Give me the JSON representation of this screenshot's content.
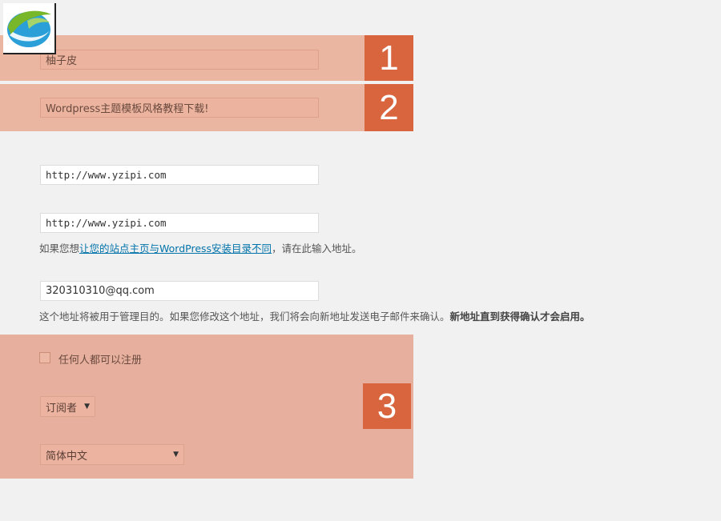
{
  "site": {
    "title_value": "柚子皮",
    "tagline_value": "Wordpress主题模板风格教程下载!",
    "wp_address_value": "http://www.yzipi.com",
    "site_address_value": "http://www.yzipi.com",
    "site_address_desc_prefix": "如果您想",
    "site_address_desc_link": "让您的站点主页与WordPress安装目录不同",
    "site_address_desc_suffix": "，请在此输入地址。",
    "email_value": "320310310@qq.com",
    "email_desc_normal": "这个地址将被用于管理目的。如果您修改这个地址，我们将会向新地址发送电子邮件来确认。",
    "email_desc_bold": "新地址直到获得确认才会启用。"
  },
  "membership": {
    "anyone_can_register_label": "任何人都可以注册",
    "checked": false
  },
  "default_role": {
    "selected": "订阅者"
  },
  "site_language": {
    "selected": "简体中文"
  },
  "badges": {
    "one": "1",
    "two": "2",
    "three": "3"
  },
  "icons": {
    "logo": "leaf-globe-logo",
    "dropdown": "caret-down-icon"
  },
  "colors": {
    "band": "#eab6a2",
    "badge": "#d9653e",
    "link": "#0073aa",
    "background": "#f1f1f1"
  }
}
